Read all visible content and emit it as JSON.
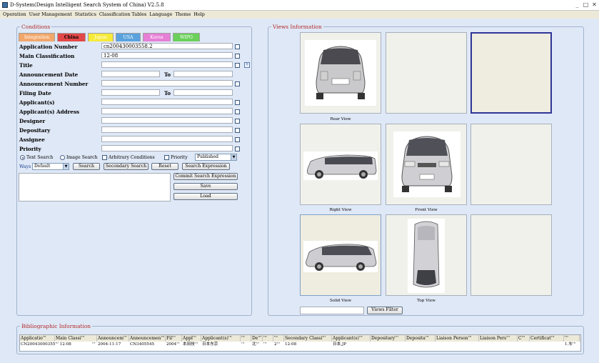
{
  "window": {
    "title": "D-System(Design Intelligent Search System of China) V2.5.8",
    "min": "_",
    "max": "□",
    "close": "✕"
  },
  "menu": [
    "Operation",
    "User Management",
    "Statistics",
    "Classification Tables",
    "Language",
    "Theme",
    "Help"
  ],
  "conditions": {
    "legend": "Conditions",
    "tabs": [
      {
        "label": "Integration",
        "color": "#f2a76b"
      },
      {
        "label": "China",
        "color": "#e34848"
      },
      {
        "label": "Japan",
        "color": "#f6ea39"
      },
      {
        "label": "USA",
        "color": "#5aa2dd"
      },
      {
        "label": "Korea",
        "color": "#e77fd6"
      },
      {
        "label": "WIPO",
        "color": "#6bd05a"
      }
    ],
    "fields": {
      "application_number": {
        "label": "Application Number",
        "value": "cn200430003558.2"
      },
      "main_classification": {
        "label": "Main Classification",
        "value": "12-08"
      },
      "title": {
        "label": "Title",
        "value": ""
      },
      "announcement_date": {
        "label": "Announcement Date",
        "from": "",
        "to": ""
      },
      "announcement_number": {
        "label": "Announcement Number",
        "value": ""
      },
      "filing_date": {
        "label": "Filing Date",
        "from": "",
        "to": ""
      },
      "applicants": {
        "label": "Applicant(s)",
        "value": ""
      },
      "applicants_address": {
        "label": "Applicant(s) Address",
        "value": ""
      },
      "designer": {
        "label": "Designer",
        "value": ""
      },
      "depositary": {
        "label": "Depositary",
        "value": ""
      },
      "assignee": {
        "label": "Assignee",
        "value": ""
      },
      "priority": {
        "label": "Priority",
        "value": ""
      }
    },
    "to_label": "To",
    "text_search": "Text Search",
    "image_search": "Image Search",
    "arbitrary_conditions": "Arbitrary Conditions",
    "priority_label": "Priority",
    "status_select": "Published",
    "ways_label": "Ways",
    "ways_value": "Default",
    "buttons": {
      "search": "Search",
      "secondary_search": "Secondary Search",
      "reset": "Reset",
      "search_expression": "Search Expression",
      "commit_search_expression": "Commit Search Expression",
      "save": "Save",
      "load": "Load"
    }
  },
  "views": {
    "legend": "Views Information",
    "captions": [
      "Rear View",
      "Right View",
      "Front View",
      "Solid View",
      "Top View"
    ],
    "filter_input": "",
    "filter_button": "Views Filter"
  },
  "biblio": {
    "legend": "Bibliographic Information",
    "columns": [
      "Applicatio'''",
      "Main Classi'''",
      "Announcem'''",
      "Announcemen'''",
      "Fil'''",
      "Appl'''",
      "Applicant(s)'''",
      "'''",
      "De'''",
      "'''",
      "'''",
      "Secondary Classi'''",
      "Applicant(s)'''",
      "Depositary'''",
      "Deposita'''",
      "Liaison Person'''",
      "Liaison Pers'''",
      "C'''",
      "Certificat'''",
      "'''"
    ],
    "row": [
      "CN20043000355''' 12-08",
      "'''",
      "2004-11-17",
      "CN3405545",
      "2004'''",
      "本田技'''",
      "日本东京",
      "'''",
      "北'''",
      "'''",
      "2'''",
      "12-08",
      "日本,JP",
      "",
      "",
      "",
      "",
      "",
      "",
      "1.车'''"
    ]
  }
}
